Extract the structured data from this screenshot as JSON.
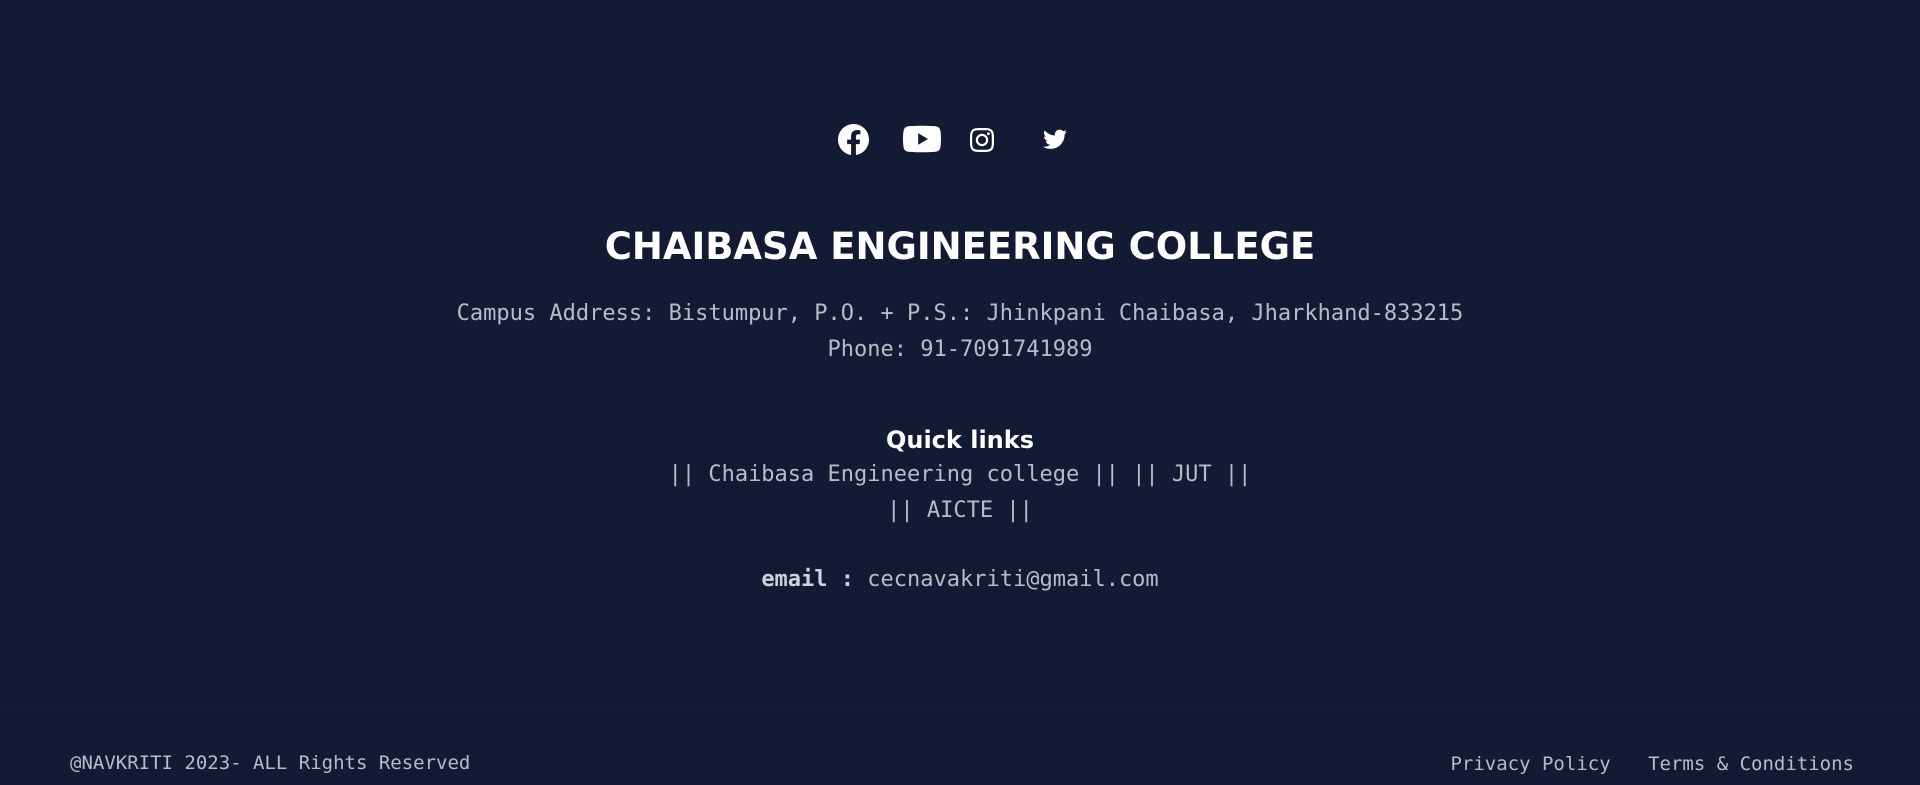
{
  "social": {
    "icons": [
      "facebook-icon",
      "youtube-icon",
      "instagram-icon",
      "twitter-icon"
    ]
  },
  "college": {
    "title": "CHAIBASA ENGINEERING COLLEGE",
    "address": "Campus Address: Bistumpur, P.O. + P.S.: Jhinkpani Chaibasa, Jharkhand-833215",
    "phone": "Phone: 91-7091741989"
  },
  "quick_links": {
    "title": "Quick links",
    "links": [
      "|| Chaibasa Engineering college ||",
      "|| JUT ||",
      "|| AICTE ||"
    ]
  },
  "email": {
    "label": "email :",
    "value": "cecnavakriti@gmail.com"
  },
  "bottom": {
    "copyright": "@NAVKRITI 2023- ALL Rights Reserved",
    "privacy": "Privacy Policy",
    "terms": "Terms & Conditions"
  },
  "colors": {
    "background": "#131a33",
    "text": "#b9bcc6",
    "heading": "#ffffff"
  }
}
